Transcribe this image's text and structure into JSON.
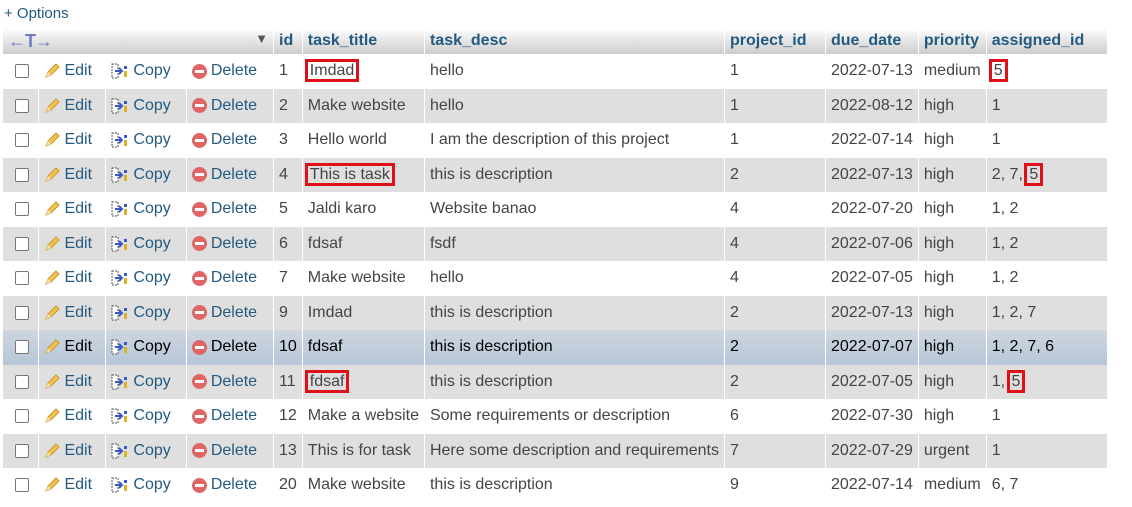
{
  "options_label": "+ Options",
  "header": {
    "arrows": "←T→",
    "sort_icon": "▼",
    "columns": [
      "id",
      "task_title",
      "task_desc",
      "project_id",
      "due_date",
      "priority",
      "assigned_id"
    ]
  },
  "actions": {
    "edit": "Edit",
    "copy": "Copy",
    "delete": "Delete"
  },
  "highlight_color": "#e0101a",
  "rows": [
    {
      "id": "1",
      "task_title": "Imdad",
      "task_desc": "hello",
      "project_id": "1",
      "due_date": "2022-07-13",
      "priority": "medium",
      "assigned_id": "5",
      "mark_title": true,
      "mark_assigned": "5"
    },
    {
      "id": "2",
      "task_title": "Make website",
      "task_desc": "hello",
      "project_id": "1",
      "due_date": "2022-08-12",
      "priority": "high",
      "assigned_id": "1"
    },
    {
      "id": "3",
      "task_title": "Hello world",
      "task_desc": "I am the description of this project",
      "project_id": "1",
      "due_date": "2022-07-14",
      "priority": "high",
      "assigned_id": "1"
    },
    {
      "id": "4",
      "task_title": "This is task",
      "task_desc": "this is description",
      "project_id": "2",
      "due_date": "2022-07-13",
      "priority": "high",
      "assigned_id": "2, 7, 5",
      "mark_title": true,
      "mark_assigned": "5"
    },
    {
      "id": "5",
      "task_title": "Jaldi karo",
      "task_desc": "Website banao",
      "project_id": "4",
      "due_date": "2022-07-20",
      "priority": "high",
      "assigned_id": "1, 2"
    },
    {
      "id": "6",
      "task_title": "fdsaf",
      "task_desc": "fsdf",
      "project_id": "4",
      "due_date": "2022-07-06",
      "priority": "high",
      "assigned_id": "1, 2"
    },
    {
      "id": "7",
      "task_title": "Make website",
      "task_desc": "hello",
      "project_id": "4",
      "due_date": "2022-07-05",
      "priority": "high",
      "assigned_id": "1, 2"
    },
    {
      "id": "9",
      "task_title": "Imdad",
      "task_desc": "this is description",
      "project_id": "2",
      "due_date": "2022-07-13",
      "priority": "high",
      "assigned_id": "1, 2, 7"
    },
    {
      "id": "10",
      "task_title": "fdsaf",
      "task_desc": "this is description",
      "project_id": "2",
      "due_date": "2022-07-07",
      "priority": "high",
      "assigned_id": "1, 2, 7, 6",
      "hover": true
    },
    {
      "id": "11",
      "task_title": "fdsaf",
      "task_desc": "this is description",
      "project_id": "2",
      "due_date": "2022-07-05",
      "priority": "high",
      "assigned_id": "1, 5",
      "mark_title": true,
      "mark_assigned": "5"
    },
    {
      "id": "12",
      "task_title": "Make a website",
      "task_desc": "Some requirements or description",
      "project_id": "6",
      "due_date": "2022-07-30",
      "priority": "high",
      "assigned_id": "1"
    },
    {
      "id": "13",
      "task_title": "This is for task",
      "task_desc": "Here some description and requirements",
      "project_id": "7",
      "due_date": "2022-07-29",
      "priority": "urgent",
      "assigned_id": "1"
    },
    {
      "id": "20",
      "task_title": "Make website",
      "task_desc": "this is description",
      "project_id": "9",
      "due_date": "2022-07-14",
      "priority": "medium",
      "assigned_id": "6, 7"
    }
  ]
}
